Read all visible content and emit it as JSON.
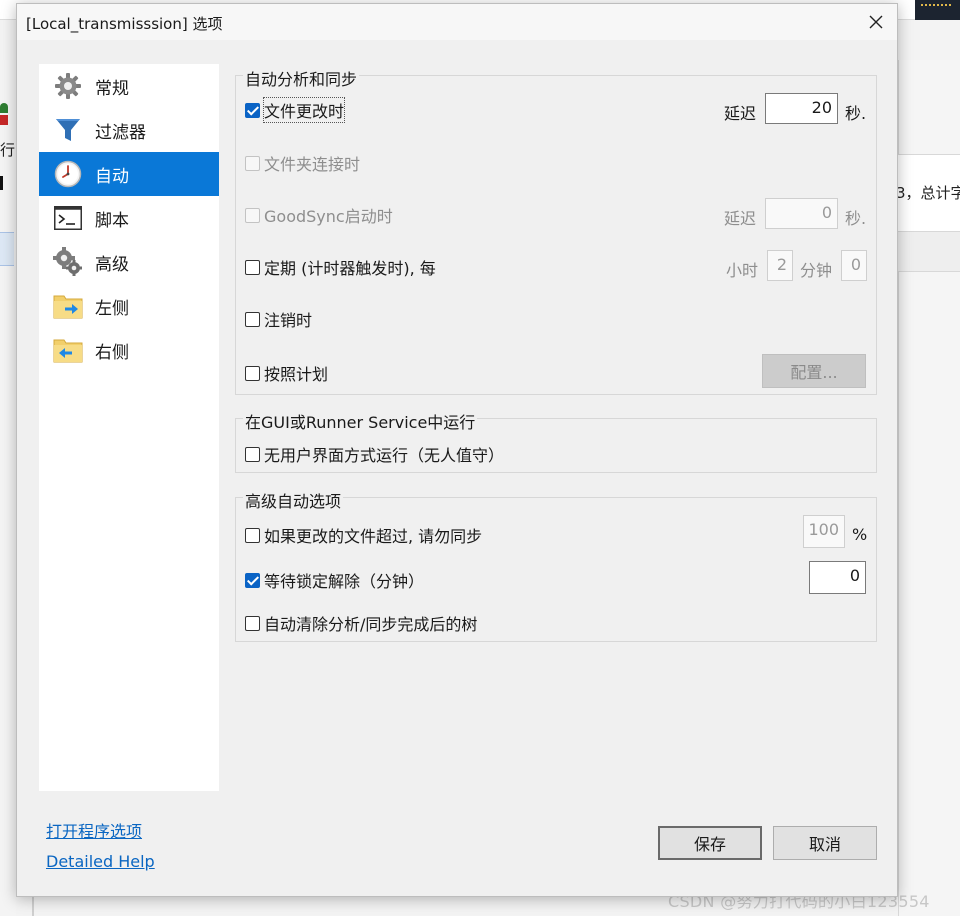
{
  "dialog": {
    "title": "[Local_transmisssion] 选项"
  },
  "background": {
    "right_text": "3，总计字",
    "left_char": "行",
    "watermark": "CSDN @努力打代码的小白123554"
  },
  "nav": {
    "items": [
      {
        "label": "常规",
        "icon": "gear-icon"
      },
      {
        "label": "过滤器",
        "icon": "filter-icon"
      },
      {
        "label": "自动",
        "icon": "clock-icon",
        "selected": true
      },
      {
        "label": "脚本",
        "icon": "terminal-icon"
      },
      {
        "label": "高级",
        "icon": "gears-icon"
      },
      {
        "label": "左侧",
        "icon": "folder-right-arrow-icon"
      },
      {
        "label": "右侧",
        "icon": "folder-left-arrow-icon"
      }
    ]
  },
  "auto_sync": {
    "title": "自动分析和同步",
    "on_file_change": {
      "label": "文件更改时",
      "checked": true,
      "delay_label": "延迟",
      "delay_value": "20",
      "unit": "秒."
    },
    "on_folder_connect": {
      "label": "文件夹连接时",
      "checked": false,
      "enabled": false
    },
    "on_goodsync_start": {
      "label": "GoodSync启动时",
      "checked": false,
      "enabled": false,
      "delay_label": "延迟",
      "delay_value": "0",
      "unit": "秒."
    },
    "periodic": {
      "label": "定期 (计时器触发时), 每",
      "checked": false,
      "hours_label": "小时",
      "hours_value": "2",
      "minutes_label": "分钟",
      "minutes_value": "0"
    },
    "on_logoff": {
      "label": "注销时",
      "checked": false
    },
    "scheduled": {
      "label": "按照计划",
      "checked": false,
      "configure_button": "配置..."
    }
  },
  "run_mode": {
    "title": "在GUI或Runner Service中运行",
    "unattended": {
      "label": "无用户界面方式运行（无人值守）",
      "checked": false
    }
  },
  "advanced_auto": {
    "title": "高级自动选项",
    "skip_if_exceeds": {
      "label": "如果更改的文件超过, 请勿同步",
      "checked": false,
      "value": "100",
      "unit": "%"
    },
    "wait_lock": {
      "label": "等待锁定解除（分钟）",
      "checked": true,
      "value": "0"
    },
    "auto_clear_tree": {
      "label": "自动清除分析/同步完成后的树",
      "checked": false
    }
  },
  "footer": {
    "open_program_options": "打开程序选项",
    "detailed_help": "Detailed Help",
    "save": "保存",
    "cancel": "取消"
  },
  "colors": {
    "selection": "#0a78d7",
    "checkbox_checked": "#0a63c5",
    "link": "#0a66c2"
  }
}
